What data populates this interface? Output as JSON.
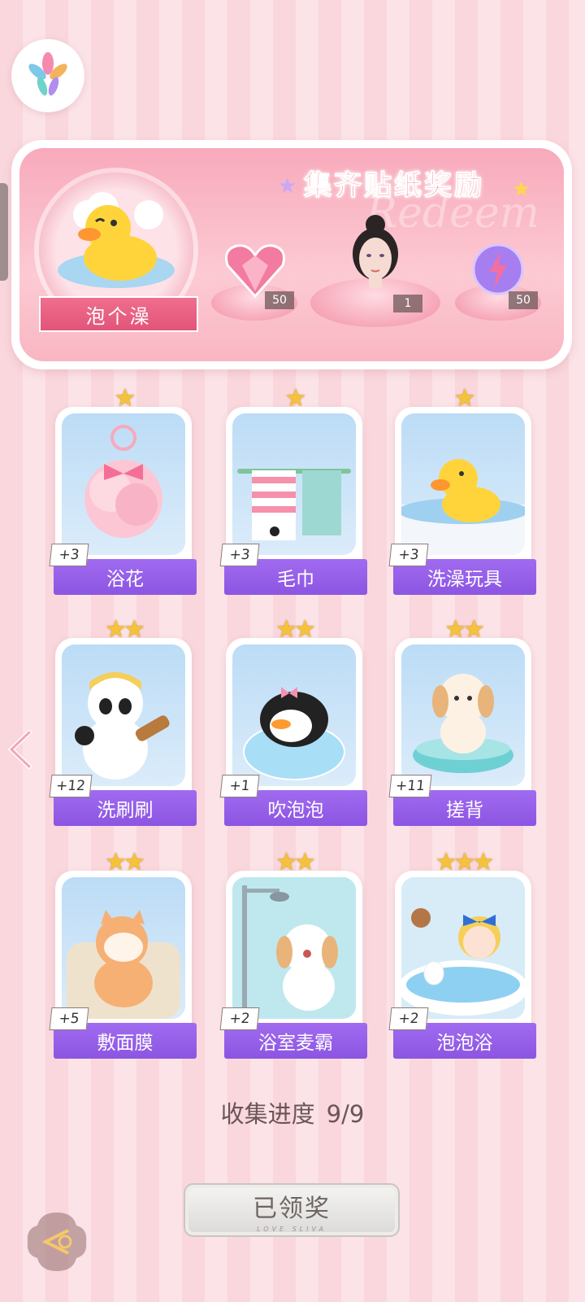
{
  "banner": {
    "title": "集齐贴纸奖励",
    "watermark": "Redeem",
    "main_reward_label": "泡个澡",
    "rewards": [
      {
        "icon": "pink-heart-gem-icon",
        "count": "50"
      },
      {
        "icon": "avatar-portrait-icon",
        "count": "1"
      },
      {
        "icon": "lightning-orb-icon",
        "count": "50"
      }
    ]
  },
  "cards": [
    {
      "name": "浴花",
      "plus": "+3",
      "stars": "★"
    },
    {
      "name": "毛巾",
      "plus": "+3",
      "stars": "★"
    },
    {
      "name": "洗澡玩具",
      "plus": "+3",
      "stars": "★"
    },
    {
      "name": "洗刷刷",
      "plus": "+12",
      "stars": "★★"
    },
    {
      "name": "吹泡泡",
      "plus": "+1",
      "stars": "★★"
    },
    {
      "name": "搓背",
      "plus": "+11",
      "stars": "★★"
    },
    {
      "name": "敷面膜",
      "plus": "+5",
      "stars": "★★"
    },
    {
      "name": "浴室麦霸",
      "plus": "+2",
      "stars": "★★"
    },
    {
      "name": "泡泡浴",
      "plus": "+2",
      "stars": "★★★"
    }
  ],
  "progress": {
    "label": "收集进度",
    "value": "9/9"
  },
  "claim_button": {
    "label": "已领奖",
    "sub": "LOVE SLIVA"
  },
  "colors": {
    "accent_pink": "#ee5d84",
    "ribbon_purple": "#9460e8",
    "star_gold": "#f6c23a"
  }
}
